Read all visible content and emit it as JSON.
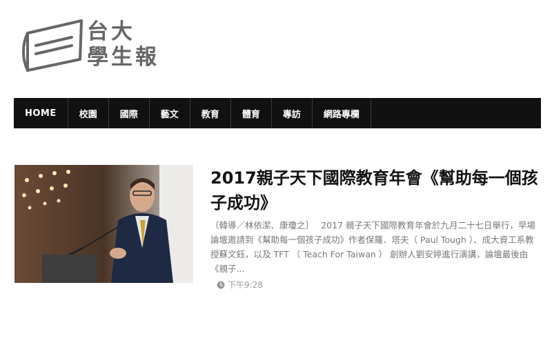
{
  "site": {
    "logo_line1": "台大",
    "logo_line2": "學生報"
  },
  "nav": {
    "items": [
      {
        "label": "HOME"
      },
      {
        "label": "校園"
      },
      {
        "label": "國際"
      },
      {
        "label": "藝文"
      },
      {
        "label": "教育"
      },
      {
        "label": "體育"
      },
      {
        "label": "專訪"
      },
      {
        "label": "網路專欄"
      }
    ]
  },
  "article": {
    "title": "2017親子天下國際教育年會《幫助每一個孩子成功》",
    "excerpt": "〔韓導／林依潔、康瓊之〕　 2017 親子天下國際教育年會於九月二十七日舉行，早場論壇邀請到《幫助每一個孩子成功》作者保羅．塔夫（ Paul Tough ）、成大資工系教授蘇文鈺，以及 TFT （ Teach For Taiwan ） 創辦人劉安婷進行演講，論壇最後由《親子...",
    "time": "下午9:28"
  },
  "colors": {
    "nav_bg": "#111111",
    "logo": "#666666",
    "title": "#111111",
    "excerpt": "#777777",
    "meta": "#999999"
  },
  "icons": {
    "logo": "newspaper-logo-icon",
    "time": "clock-icon"
  }
}
